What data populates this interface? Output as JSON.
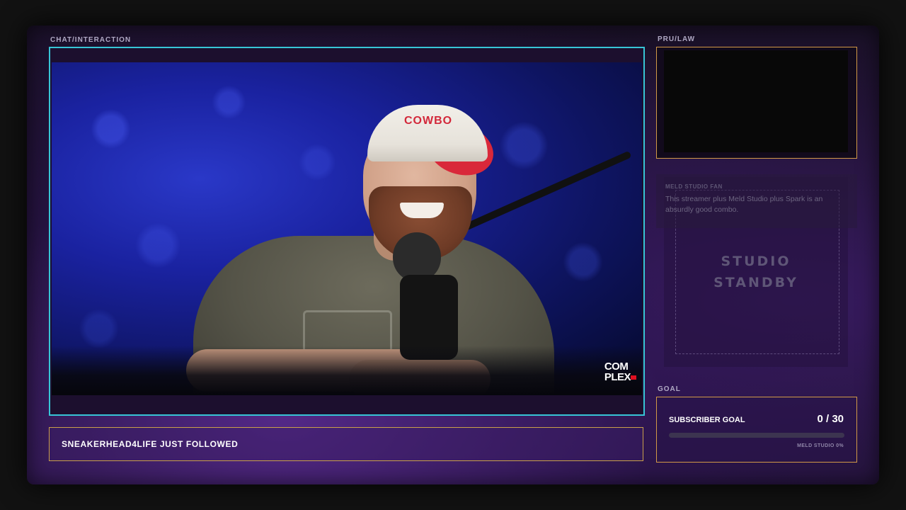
{
  "panels": {
    "chat_label": "CHAT/INTERACTION",
    "pru_label": "PRU/LAW",
    "goal_label": "GOAL"
  },
  "video": {
    "logo_line1": "COM",
    "logo_line2": "PLEX",
    "cap_text": "COWBO"
  },
  "alert": {
    "text": "SNEAKERHEAD4LIFE JUST FOLLOWED"
  },
  "chat": {
    "author": "MELD STUDIO FAN",
    "message": "This streamer plus Meld Studio plus Spark is an absurdly good combo."
  },
  "standby": {
    "line1": "STUDIO",
    "line2": "STANDBY"
  },
  "goal": {
    "title": "SUBSCRIBER GOAL",
    "count": "0 / 30",
    "progress_fraction": 0,
    "footer": "MELD STUDIO 0%"
  },
  "colors": {
    "video_border": "#37c5d6",
    "accent_gold": "#c9a04a",
    "box_border_orange": "#d29a47",
    "frame_purple": "#3a1c64"
  }
}
